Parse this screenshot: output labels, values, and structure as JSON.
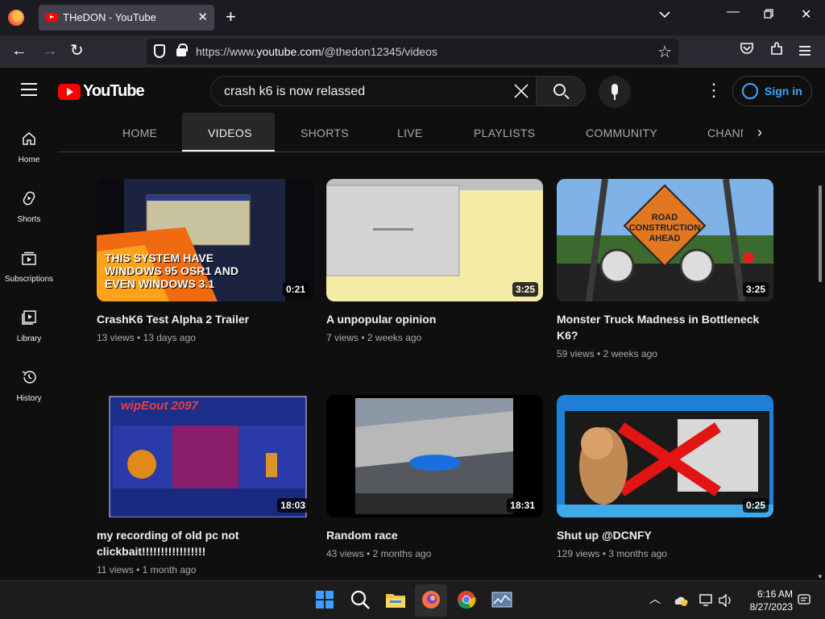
{
  "browser": {
    "tab_title": "THeDON - YouTube",
    "url_prefix": "https://www.",
    "url_domain": "youtube.com",
    "url_path": "/@thedon12345/videos"
  },
  "youtube": {
    "logo_text": "YouTube",
    "search_value": "crash k6 is now relassed",
    "signin_label": "Sign in"
  },
  "rail": [
    {
      "label": "Home"
    },
    {
      "label": "Shorts"
    },
    {
      "label": "Subscriptions"
    },
    {
      "label": "Library"
    },
    {
      "label": "History"
    }
  ],
  "channel_tabs": [
    "HOME",
    "VIDEOS",
    "SHORTS",
    "LIVE",
    "PLAYLISTS",
    "COMMUNITY",
    "CHANNELS"
  ],
  "active_tab": "VIDEOS",
  "videos": [
    {
      "title": "CrashK6 Test Alpha 2 Trailer",
      "duration": "0:21",
      "views": "13 views",
      "age": "13 days ago",
      "thumb_text": "THIS SYSTEM HAVE WINDOWS 95 OSR1 AND EVEN WINDOWS 3.1"
    },
    {
      "title": "A unpopular opinion",
      "duration": "3:25",
      "views": "7 views",
      "age": "2 weeks ago"
    },
    {
      "title": "Monster Truck Madness in Bottleneck K6?",
      "duration": "3:25",
      "views": "59 views",
      "age": "2 weeks ago",
      "thumb_text": "ROAD CONSTRUCTION AHEAD"
    },
    {
      "title": "my recording of old pc not clickbait!!!!!!!!!!!!!!!!!",
      "duration": "18:03",
      "views": "11 views",
      "age": "1 month ago",
      "thumb_text": "wipEout 2097"
    },
    {
      "title": "Random race",
      "duration": "18:31",
      "views": "43 views",
      "age": "2 months ago"
    },
    {
      "title": "Shut up @DCNFY",
      "duration": "0:25",
      "views": "129 views",
      "age": "3 months ago"
    }
  ],
  "taskbar": {
    "time": "6:16 AM",
    "date": "8/27/2023"
  }
}
